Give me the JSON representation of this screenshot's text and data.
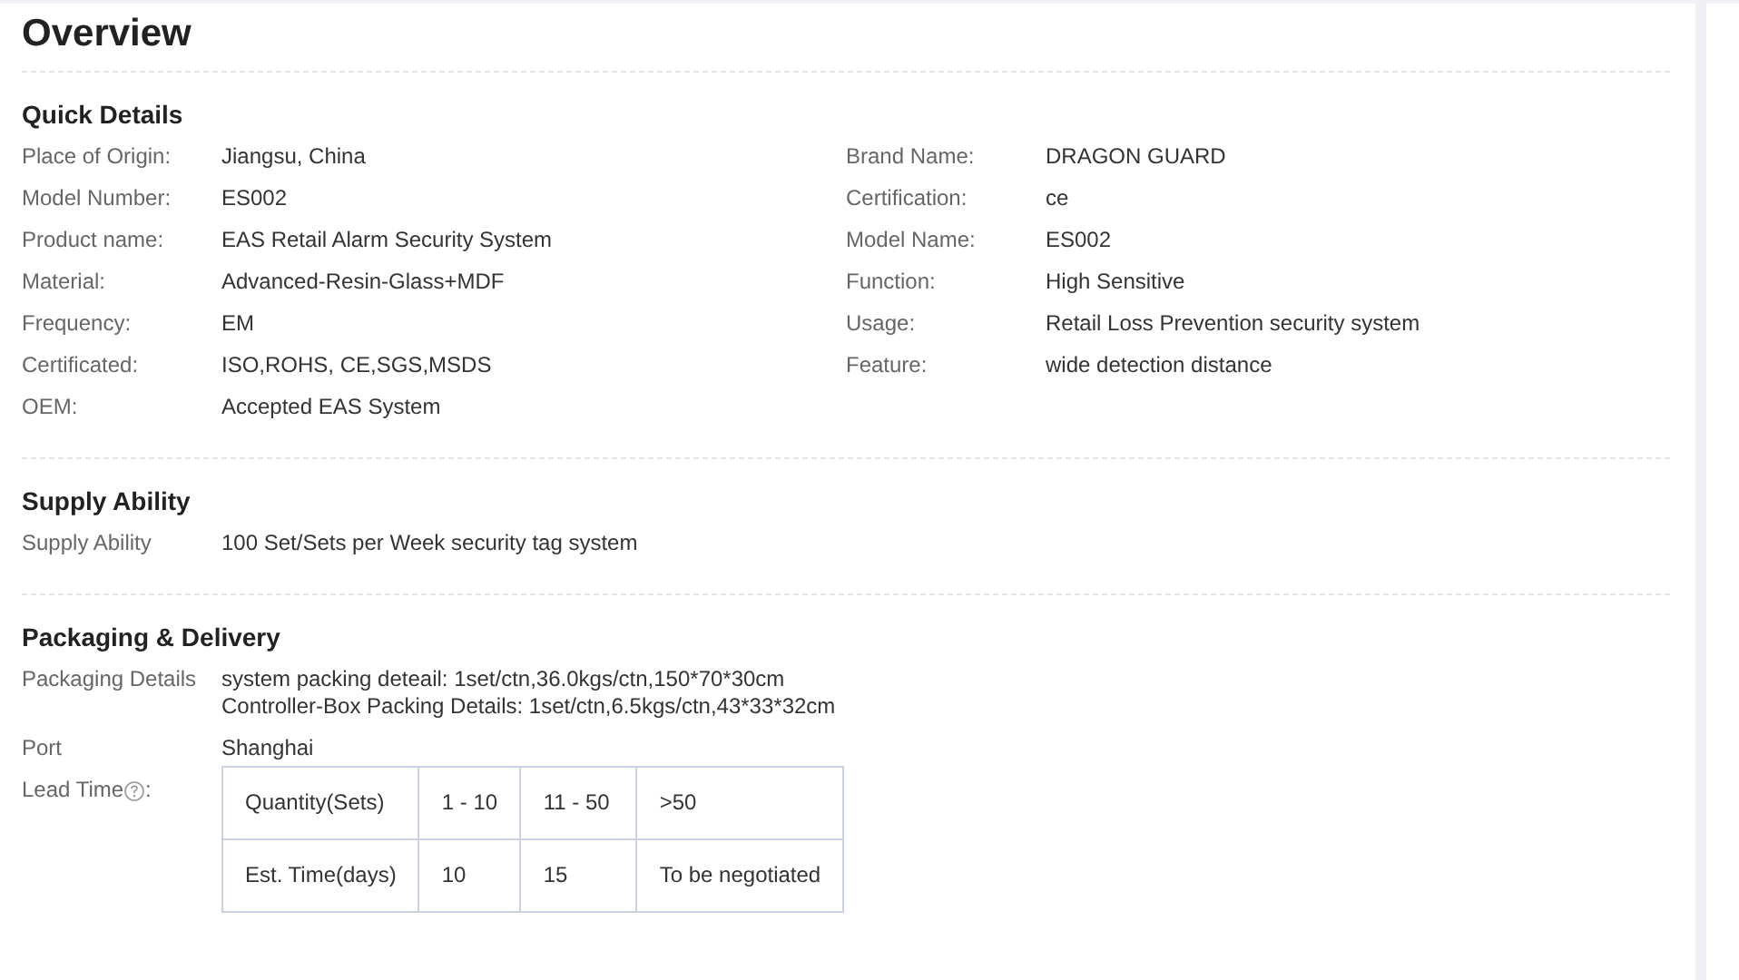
{
  "title": "Overview",
  "quick_details": {
    "heading": "Quick Details",
    "left": [
      {
        "label": "Place of Origin:",
        "value": "Jiangsu, China"
      },
      {
        "label": "Model Number:",
        "value": "ES002"
      },
      {
        "label": "Product name:",
        "value": "EAS Retail Alarm Security System"
      },
      {
        "label": "Material:",
        "value": "Advanced-Resin-Glass+MDF"
      },
      {
        "label": "Frequency:",
        "value": "EM"
      },
      {
        "label": "Certificated:",
        "value": "ISO,ROHS, CE,SGS,MSDS"
      },
      {
        "label": "OEM:",
        "value": "Accepted EAS System"
      }
    ],
    "right": [
      {
        "label": "Brand Name:",
        "value": "DRAGON GUARD"
      },
      {
        "label": "Certification:",
        "value": "ce"
      },
      {
        "label": "Model Name:",
        "value": "ES002"
      },
      {
        "label": "Function:",
        "value": "High Sensitive"
      },
      {
        "label": "Usage:",
        "value": "Retail Loss Prevention security system"
      },
      {
        "label": "Feature:",
        "value": "wide detection distance"
      }
    ]
  },
  "supply_ability": {
    "heading": "Supply Ability",
    "rows": [
      {
        "label": "Supply Ability",
        "value": "100 Set/Sets per Week security tag system"
      }
    ]
  },
  "packaging_delivery": {
    "heading": "Packaging & Delivery",
    "rows": [
      {
        "label": "Packaging Details",
        "lines": [
          "system packing deteail: 1set/ctn,36.0kgs/ctn,150*70*30cm",
          "Controller-Box Packing Details: 1set/ctn,6.5kgs/ctn,43*33*32cm"
        ]
      },
      {
        "label": "Port",
        "lines": [
          "Shanghai"
        ]
      }
    ],
    "lead_time": {
      "label": "Lead Time",
      "help": true,
      "suffix": ":",
      "table": [
        [
          "Quantity(Sets)",
          "1 - 10",
          "11 - 50",
          ">50"
        ],
        [
          "Est. Time(days)",
          "10",
          "15",
          "To be negotiated"
        ]
      ]
    }
  }
}
